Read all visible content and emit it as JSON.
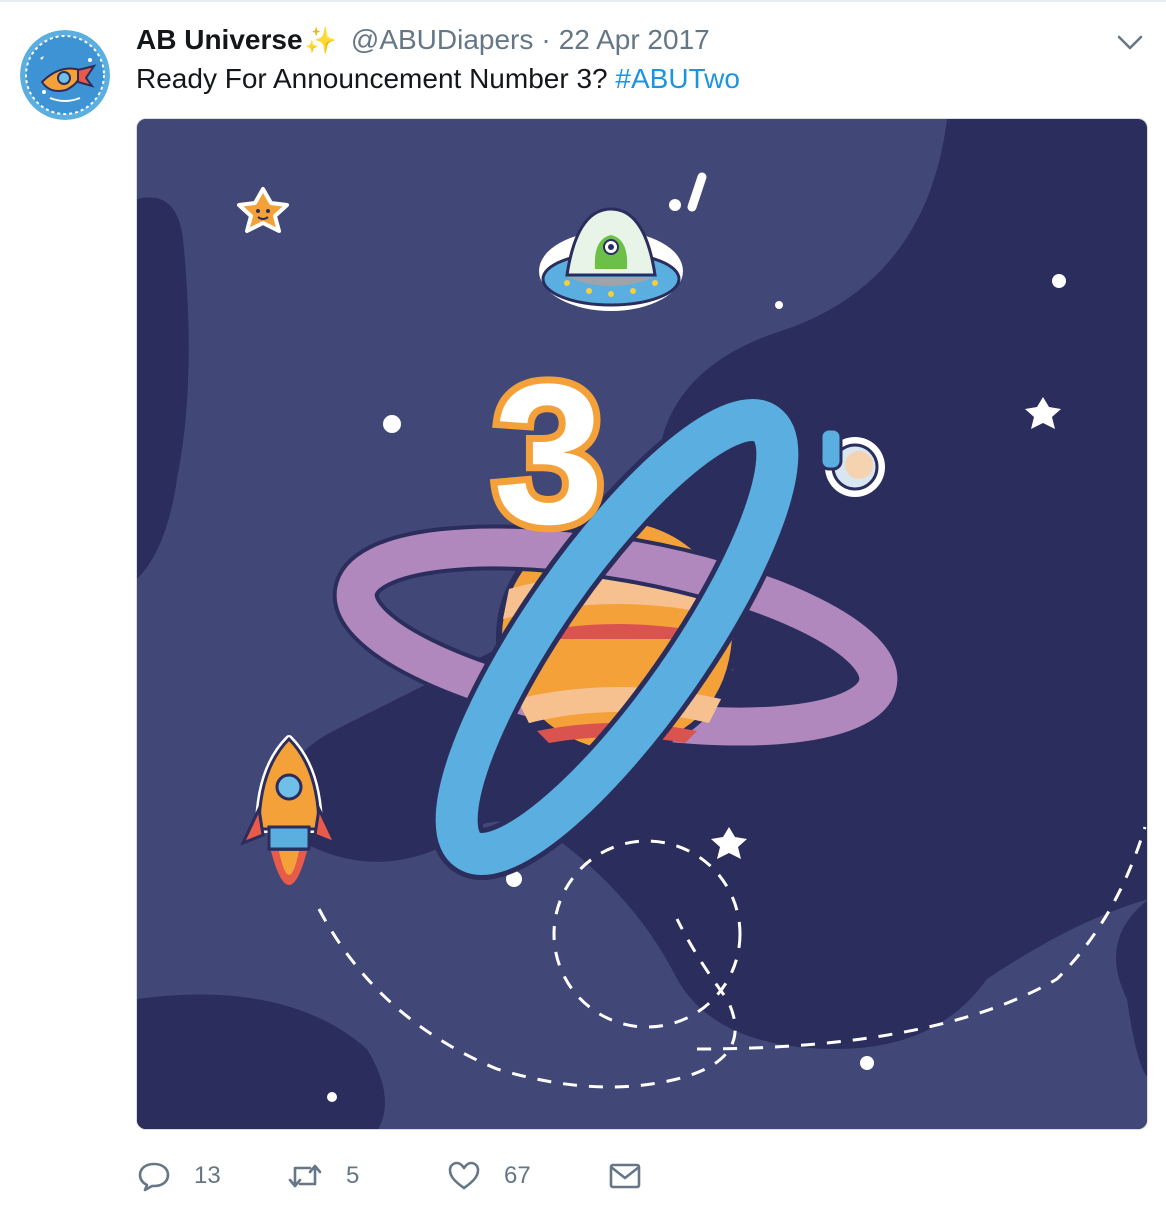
{
  "tweet": {
    "display_name": "AB Universe",
    "name_emoji": "✨",
    "handle": "@ABUDiapers",
    "separator": "·",
    "date": "22 Apr 2017",
    "text": "Ready For Announcement Number 3? ",
    "hashtag": "#ABUTwo"
  },
  "media": {
    "big_number": "3",
    "exclamation": "!"
  },
  "actions": {
    "reply_count": "13",
    "retweet_count": "5",
    "like_count": "67"
  },
  "colors": {
    "text": "#14171a",
    "secondary": "#657786",
    "link": "#1b95e0",
    "space_dark": "#2b2d5c",
    "space_light": "#414877"
  },
  "icons": [
    "caret-down-icon",
    "reply-icon",
    "retweet-icon",
    "like-icon",
    "direct-message-icon"
  ]
}
